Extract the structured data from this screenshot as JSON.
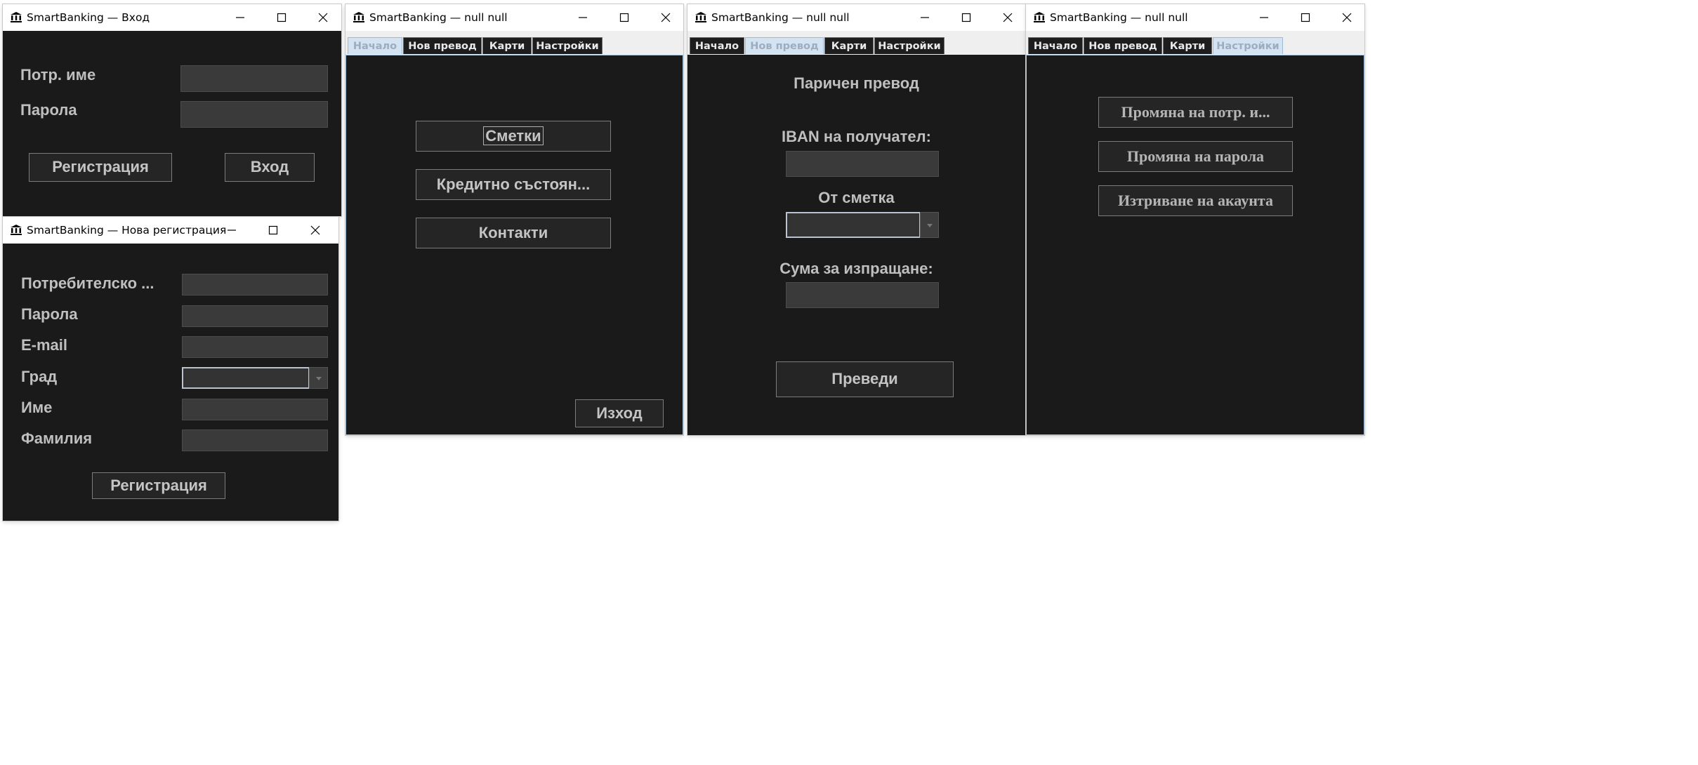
{
  "colors": {
    "window_bg": "#1a1a1a",
    "tab_active_bg": "#d4e3f2",
    "tab_active_text": "#9dacbf",
    "field_bg": "#3a3a3a",
    "button_border": "#7c7c7c"
  },
  "icons": {
    "app": "bank-icon",
    "minimize": "minimize-icon",
    "maximize": "maximize-icon",
    "close": "close-icon"
  },
  "login": {
    "title": "SmartBanking — Вход",
    "username_label": "Потр. име",
    "password_label": "Парола",
    "register_button": "Регистрация",
    "login_button": "Вход"
  },
  "registration": {
    "title": "SmartBanking — Нова регистрация",
    "username_label": "Потребителско ...",
    "password_label": "Парола",
    "email_label": "E-mail",
    "city_label": "Град",
    "first_name_label": "Име",
    "last_name_label": "Фамилия",
    "register_button": "Регистрация"
  },
  "tabs": [
    "Начало",
    "Нов превод",
    "Карти",
    "Настройки"
  ],
  "home": {
    "title": "SmartBanking — null null",
    "accounts_button": "Сметки",
    "credit_button": "Кредитно състоян...",
    "contacts_button": "Контакти",
    "exit_button": "Изход"
  },
  "transfer": {
    "title": "SmartBanking — null null",
    "heading": "Паричен превод",
    "iban_label": "IBAN на получател:",
    "from_account_label": "От сметка",
    "amount_label": "Сума за изпращане:",
    "transfer_button": "Преведи"
  },
  "settings": {
    "title": "SmartBanking — null null",
    "change_username_button": "Промяна на потр. и...",
    "change_password_button": "Промяна на парола",
    "delete_account_button": "Изтриване на акаунта"
  }
}
